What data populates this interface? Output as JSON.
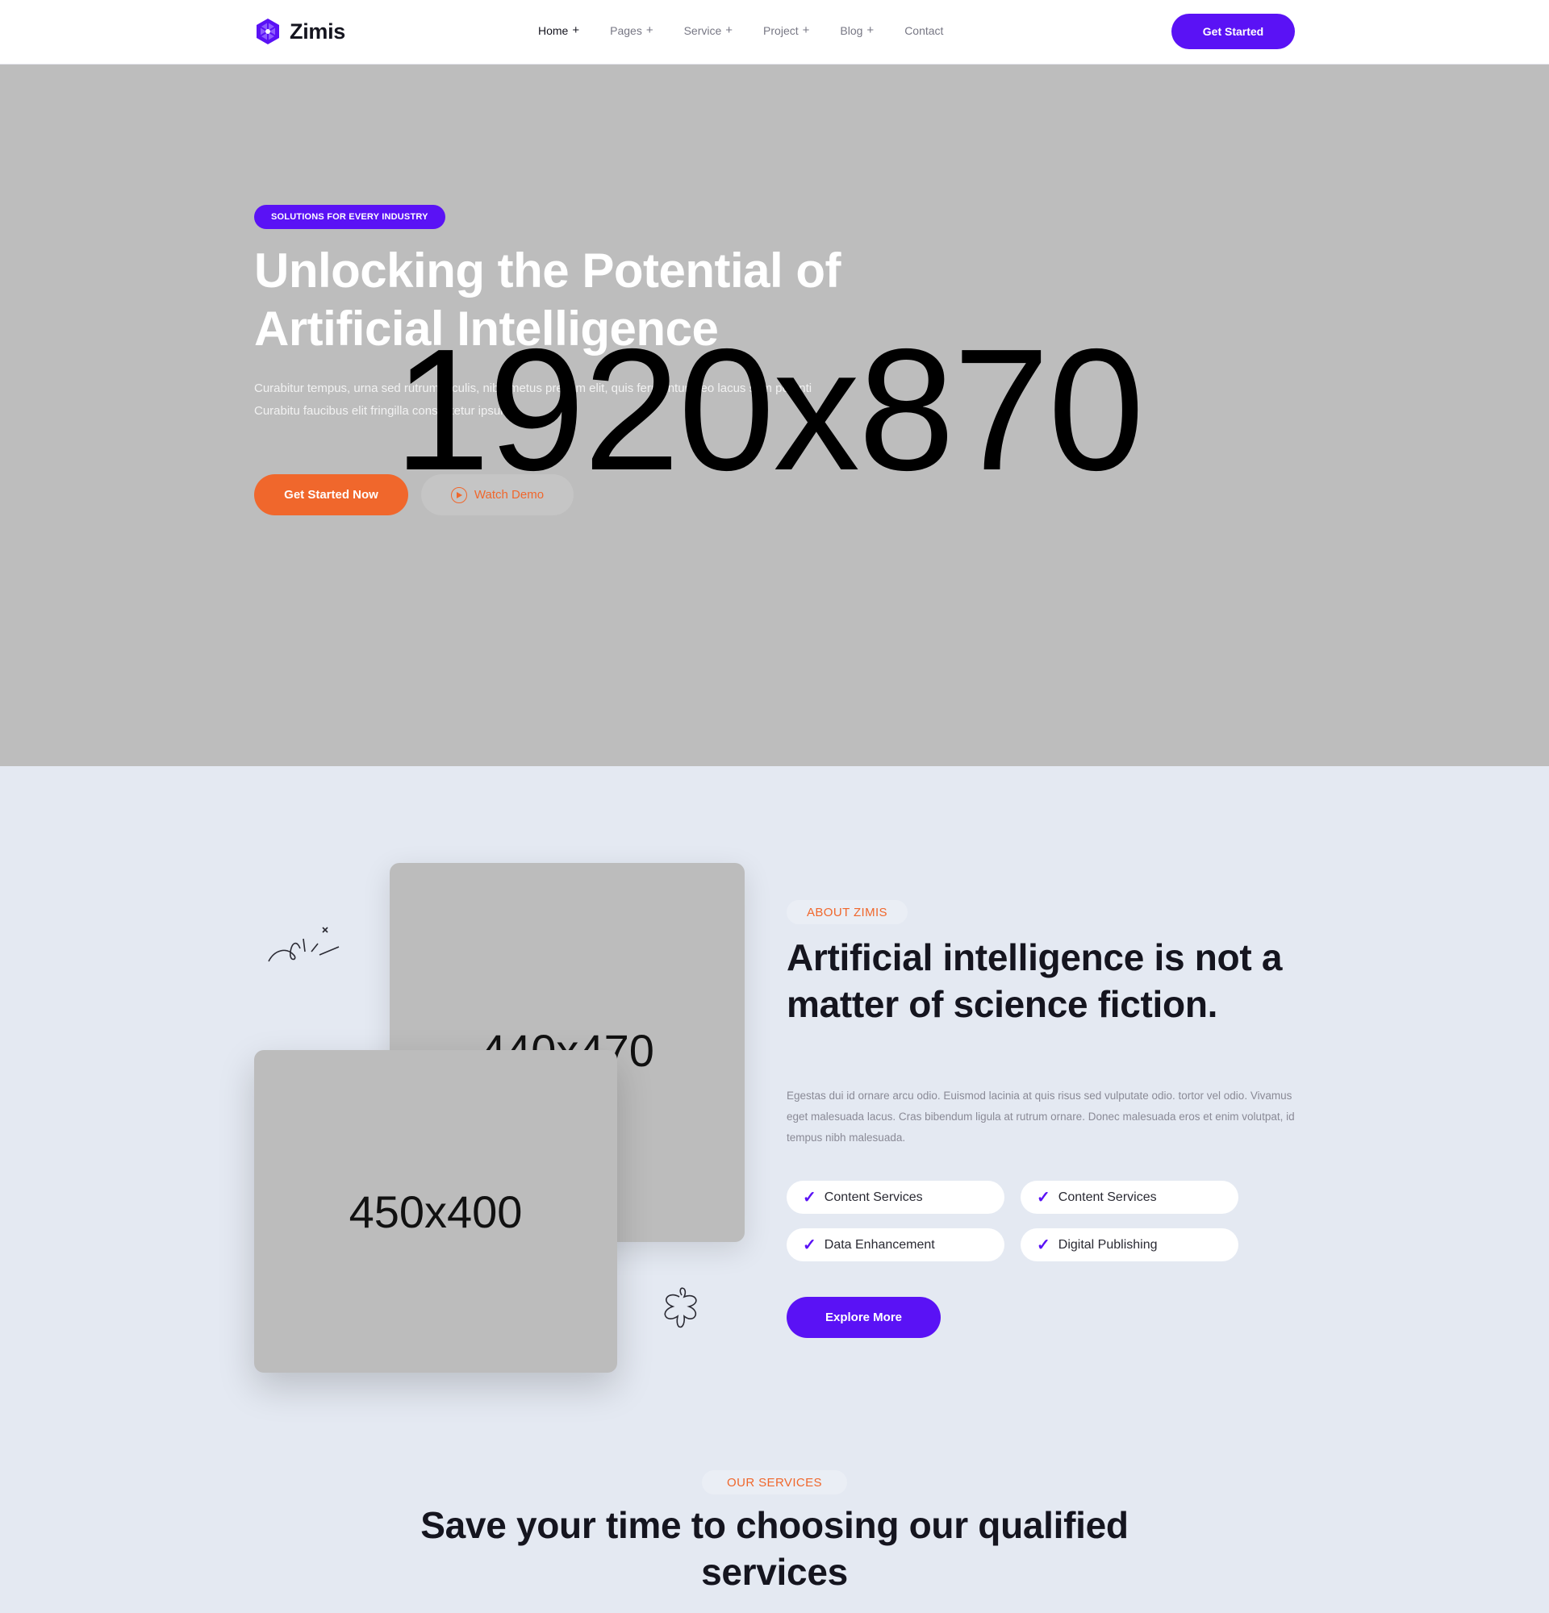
{
  "header": {
    "logo_text": "Zimis",
    "nav": [
      {
        "label": "Home",
        "suffix": "+"
      },
      {
        "label": "Pages",
        "suffix": "+"
      },
      {
        "label": "Service",
        "suffix": "+"
      },
      {
        "label": "Project",
        "suffix": "+"
      },
      {
        "label": "Blog",
        "suffix": "+"
      },
      {
        "label": "Contact",
        "suffix": ""
      }
    ],
    "cta_label": "Get Started"
  },
  "hero": {
    "placeholder_label": "1920x870",
    "badge": "SOLUTIONS FOR EVERY INDUSTRY",
    "title": "Unlocking the Potential of Artificial Intelligence",
    "description": "Curabitur tempus, urna sed rutrum iaculis, nibh metus pretium elit, quis fermentum leo lacus sem potenti Curabitu faucibus elit fringilla consectetur ipsum.",
    "primary_button": "Get Started Now",
    "secondary_button": "Watch Demo"
  },
  "about": {
    "image_back_label": "440x470",
    "image_front_label": "450x400",
    "label": "ABOUT ZIMIS",
    "title": "Artificial intelligence is not a matter of science fiction.",
    "description": "Egestas dui id ornare arcu odio. Euismod lacinia at quis risus sed vulputate odio. tortor vel odio. Vivamus eget malesuada lacus. Cras bibendum ligula at rutrum ornare. Donec malesuada eros et enim volutpat, id tempus nibh malesuada.",
    "features": [
      "Content Services",
      "Content Services",
      "Data Enhancement",
      "Digital Publishing"
    ],
    "button": "Explore More"
  },
  "services": {
    "label": "OUR SERVICES",
    "title": "Save your time to choosing our qualified services"
  },
  "colors": {
    "primary": "#5a12f5",
    "accent": "#f0672c",
    "background": "#e4e9f2"
  },
  "icons": [
    "logo-icon",
    "play-icon",
    "check-icon",
    "sparkle-doodle-icon",
    "clover-doodle-icon"
  ]
}
